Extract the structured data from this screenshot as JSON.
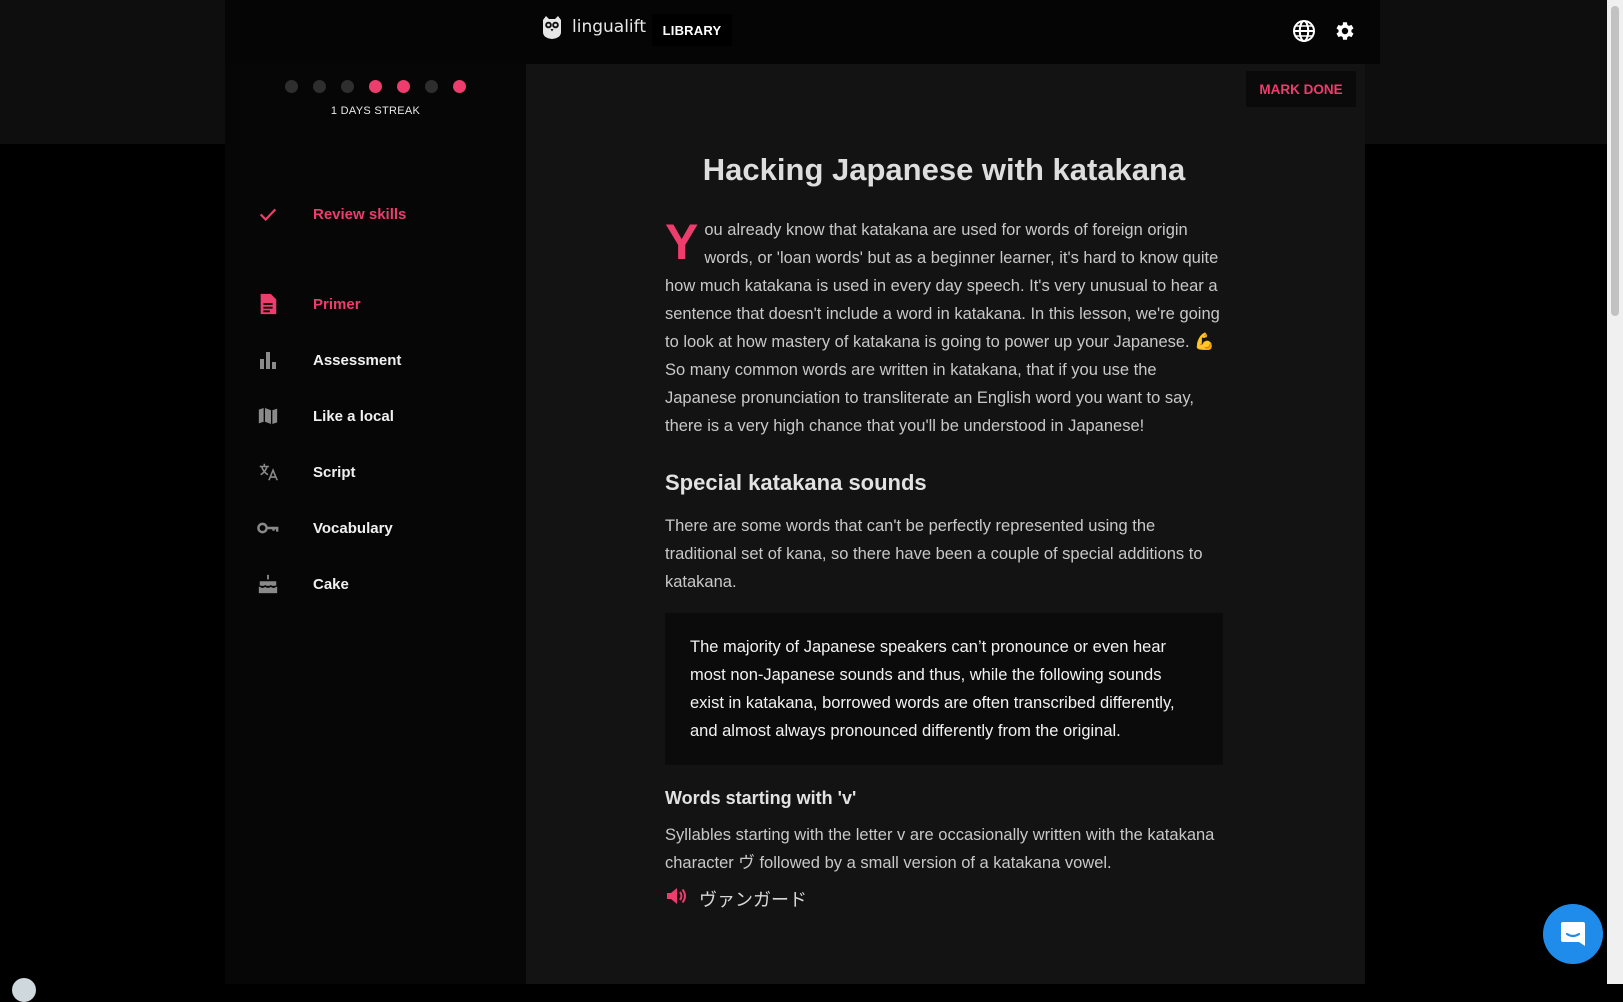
{
  "header": {
    "logo_text": "lingualift",
    "library_label": "LIBRARY",
    "icons": [
      "globe-icon",
      "gear-icon"
    ]
  },
  "sidebar": {
    "streak": {
      "dots": [
        false,
        false,
        false,
        true,
        true,
        false,
        true
      ],
      "label": "1 DAYS STREAK"
    },
    "items": [
      {
        "label": "Review skills",
        "icon": "check-icon",
        "active": true
      },
      {
        "label": "Primer",
        "icon": "document-icon",
        "active": true
      },
      {
        "label": "Assessment",
        "icon": "bar-chart-icon",
        "active": false
      },
      {
        "label": "Like a local",
        "icon": "map-icon",
        "active": false
      },
      {
        "label": "Script",
        "icon": "translate-icon",
        "active": false
      },
      {
        "label": "Vocabulary",
        "icon": "key-icon",
        "active": false
      },
      {
        "label": "Cake",
        "icon": "cake-icon",
        "active": false
      }
    ]
  },
  "main": {
    "mark_done_label": "MARK DONE",
    "title": "Hacking Japanese with katakana",
    "intro_dropcap": "Y",
    "intro_text_1": "ou already know that katakana are used for words of foreign origin words, or 'loan words' but as a beginner learner, it's hard to know quite how much katakana is used in every day speech. It's very unusual to hear a sentence that doesn't include a word in katakana. In this lesson, we're going to look at how mastery of katakana is going to power up your Japanese.",
    "intro_emoji": "💪",
    "intro_text_2": "So many common words are written in katakana, that if you use the Japanese pronunciation to transliterate an English word you want to say, there is a very high chance that you'll be understood in Japanese!",
    "section1_heading": "Special katakana sounds",
    "section1_text": "There are some words that can't be perfectly represented using the traditional set of kana, so there have been a couple of special additions to katakana.",
    "callout_text": "The majority of Japanese speakers can’t pronounce or even hear most non-Japanese sounds and thus, while the following sounds exist in katakana, borrowed words are often transcribed differently, and almost always pronounced differently from the original.",
    "section2_heading": "Words starting with 'v'",
    "section2_text": "Syllables starting with the letter v are occasionally written with the katakana character ヴ followed by a small version of a katakana vowel.",
    "audio_word": "ヴァンガード"
  },
  "colors": {
    "accent": "#ec3d6c",
    "chat_bubble": "#1f8ceb"
  }
}
